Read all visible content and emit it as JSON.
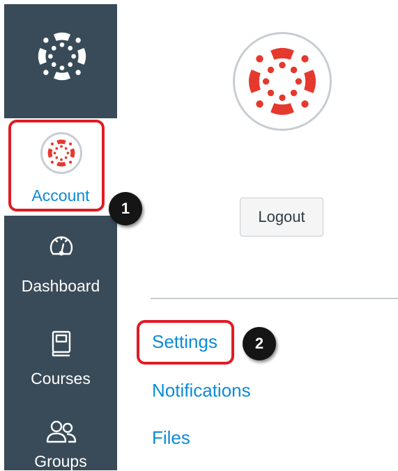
{
  "global_nav": {
    "account_label": "Account",
    "items": [
      {
        "label": "Dashboard",
        "icon": "dashboard-icon"
      },
      {
        "label": "Courses",
        "icon": "courses-icon"
      },
      {
        "label": "Groups",
        "icon": "groups-icon"
      }
    ]
  },
  "account_tray": {
    "logout_label": "Logout",
    "links": [
      "Settings",
      "Notifications",
      "Files"
    ]
  },
  "callouts": {
    "step1": "1",
    "step2": "2"
  },
  "colors": {
    "nav_background": "#394b58",
    "brand_red": "#e5392d",
    "link_blue": "#0b8bd6",
    "callout_red": "#e01b24"
  }
}
